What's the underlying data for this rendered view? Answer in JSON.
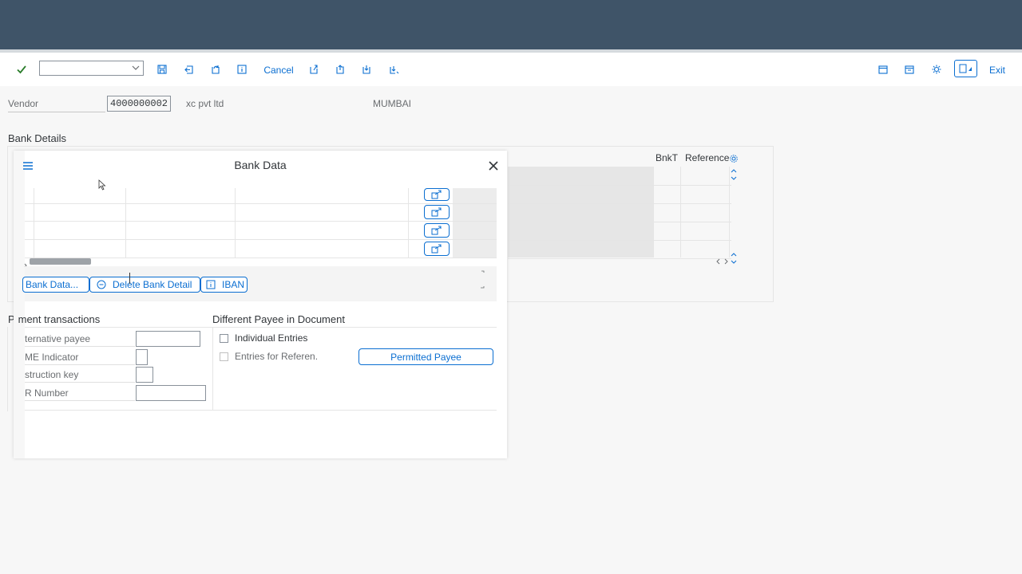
{
  "toolbar": {
    "command_field_value": "",
    "cancel_label": "Cancel",
    "exit_label": "Exit"
  },
  "header": {
    "vendor_label": "Vendor",
    "vendor_number": "4000000002",
    "vendor_name": "xc pvt ltd",
    "vendor_city": "MUMBAI"
  },
  "bank_details": {
    "title": "Bank Details",
    "columns": [
      "BnkT",
      "Reference"
    ]
  },
  "dialog": {
    "title": "Bank Data",
    "buttons": {
      "bank_data": "Bank Data...",
      "delete": "Delete Bank Detail",
      "iban": "IBAN"
    }
  },
  "payment_transactions": {
    "title": "ment transactions",
    "title_prefix": "P",
    "fields": {
      "alt_payee": "ternative payee",
      "dme_indicator": "ME Indicator",
      "instruction_key": "struction key",
      "isr_number": "R Number"
    }
  },
  "different_payee": {
    "title": "Different Payee in Document",
    "individual_entries": "Individual Entries",
    "entries_for_reference": "Entries for Referen.",
    "permitted_payee_button": "Permitted Payee"
  },
  "colors": {
    "shell": "#3f5468",
    "accent": "#0a6ed1",
    "confirm": "#2b7d2b"
  }
}
